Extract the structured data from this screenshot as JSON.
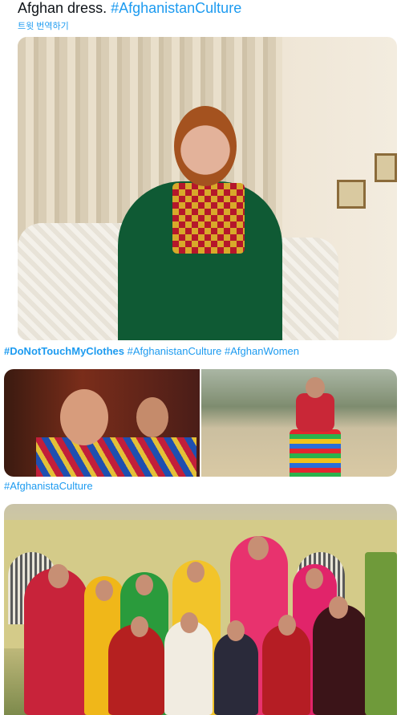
{
  "tweet": {
    "text_plain": "Afghan dress.",
    "text_tag": "#AfghanistanCulture",
    "translate_label": "트윗 번역하기"
  },
  "captions": {
    "first_bold": "#DoNotTouchMyClothes",
    "first_rest": "#AfghanistanCulture #AfghanWomen",
    "second": "#AfghanistaCulture"
  },
  "colors": {
    "link": "#1d9bf0",
    "text": "#0f1419"
  }
}
